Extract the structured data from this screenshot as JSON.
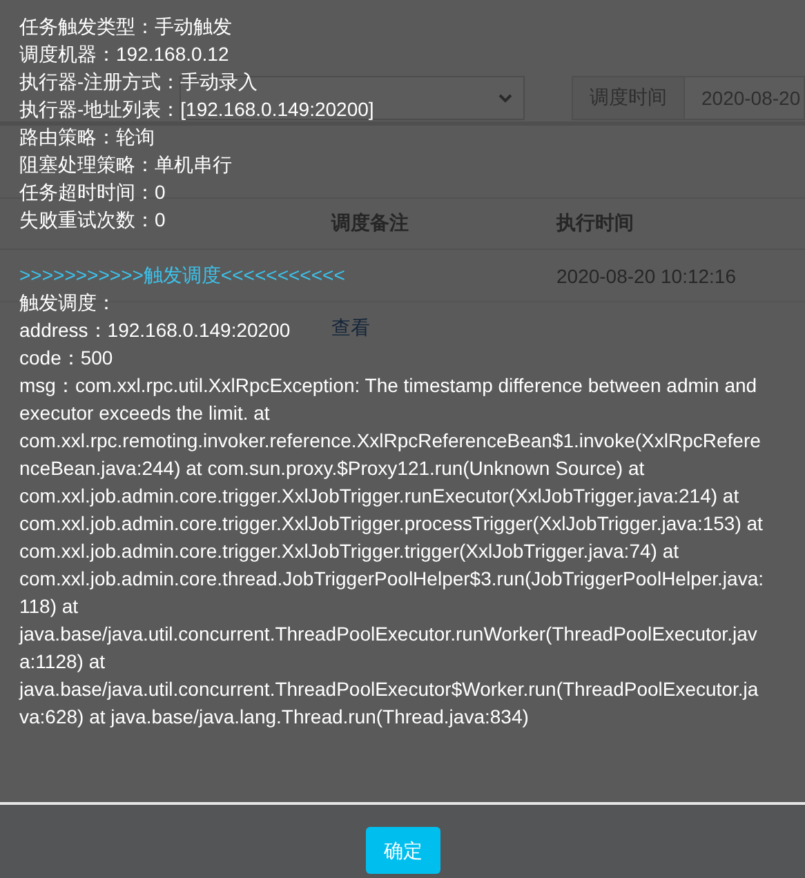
{
  "background_page": {
    "filter_bar": {
      "time_label": "调度时间",
      "time_value": "2020-08-20"
    },
    "table": {
      "columns": [
        "调度备注",
        "执行时间"
      ],
      "rows": [
        {
          "execution_time": "2020-08-20 10:12:16"
        },
        {
          "remark_link": "查看"
        }
      ]
    }
  },
  "dialog": {
    "info_lines": [
      "任务触发类型：手动触发",
      "调度机器：192.168.0.12",
      "执行器-注册方式：手动录入",
      "执行器-地址列表：[192.168.0.149:20200]",
      "路由策略：轮询",
      "阻塞处理策略：单机串行",
      "任务超时时间：0",
      "失败重试次数：0"
    ],
    "trigger_heading": ">>>>>>>>>>>触发调度<<<<<<<<<<<",
    "trigger_lines": [
      "触发调度：",
      "address：192.168.0.149:20200",
      "code：500",
      "msg：com.xxl.rpc.util.XxlRpcException: The timestamp difference between admin and executor exceeds the limit. at com.xxl.rpc.remoting.invoker.reference.XxlRpcReferenceBean$1.invoke(XxlRpcReferenceBean.java:244) at com.sun.proxy.$Proxy121.run(Unknown Source) at com.xxl.job.admin.core.trigger.XxlJobTrigger.runExecutor(XxlJobTrigger.java:214) at com.xxl.job.admin.core.trigger.XxlJobTrigger.processTrigger(XxlJobTrigger.java:153) at com.xxl.job.admin.core.trigger.XxlJobTrigger.trigger(XxlJobTrigger.java:74) at com.xxl.job.admin.core.thread.JobTriggerPoolHelper$3.run(JobTriggerPoolHelper.java:118) at java.base/java.util.concurrent.ThreadPoolExecutor.runWorker(ThreadPoolExecutor.java:1128) at java.base/java.util.concurrent.ThreadPoolExecutor$Worker.run(ThreadPoolExecutor.java:628) at java.base/java.lang.Thread.run(Thread.java:834)"
    ],
    "ok_button": "确定"
  }
}
